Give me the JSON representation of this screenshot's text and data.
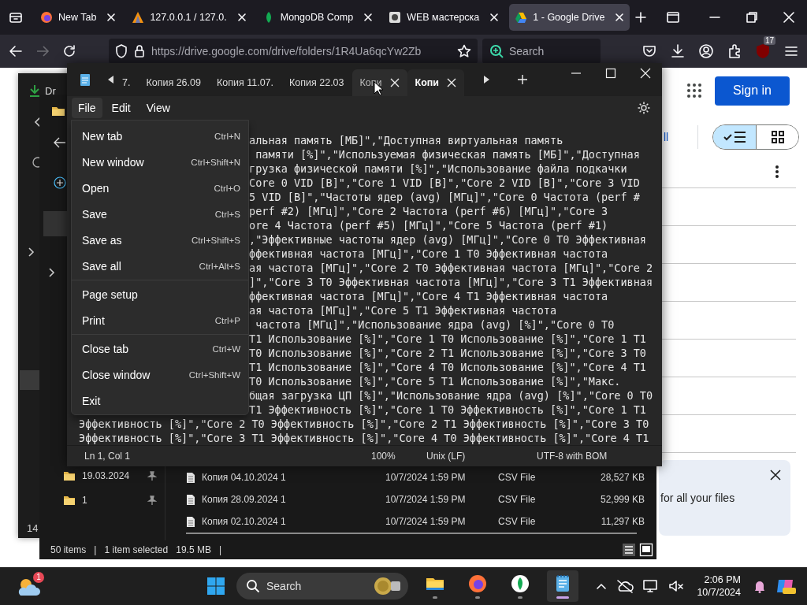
{
  "browser": {
    "tabs": [
      {
        "title": "New Tab",
        "selected": false
      },
      {
        "title": "127.0.0.1 / 127.0.",
        "selected": false
      },
      {
        "title": "MongoDB Comp",
        "selected": false
      },
      {
        "title": "WEB мастерска",
        "selected": false
      },
      {
        "title": "1 - Google Drive",
        "selected": true
      }
    ],
    "url": "https://drive.google.com/drive/folders/1R4Ua6qcYw2Zb",
    "search": {
      "placeholder": "Search"
    },
    "extension_badge": "17"
  },
  "drive_page": {
    "link": "ll",
    "sign_in": "Sign in",
    "view_toggle": [
      {
        "kind": "list",
        "selected": true
      },
      {
        "kind": "grid",
        "selected": false
      }
    ],
    "notice": {
      "text": "for all your files"
    }
  },
  "back_window": {
    "label": "Dr",
    "count": "14"
  },
  "explorer": {
    "sidebar_items": [
      {
        "label": "19.03.2024",
        "pinned": true
      },
      {
        "label": "1",
        "pinned": true
      }
    ],
    "files": [
      {
        "name": "Копия 04.10.2024 1",
        "modified": "10/7/2024 1:59 PM",
        "type": "CSV File",
        "size": "28,527 KB"
      },
      {
        "name": "Копия 28.09.2024 1",
        "modified": "10/7/2024 1:59 PM",
        "type": "CSV File",
        "size": "52,999 KB"
      },
      {
        "name": "Копия 02.10.2024 1",
        "modified": "10/7/2024 1:59 PM",
        "type": "CSV File",
        "size": "11,297 KB"
      }
    ],
    "status": [
      "50 items",
      "|",
      "1 item selected",
      "19.5 MB",
      "|"
    ]
  },
  "notepad": {
    "tabs": [
      {
        "title": "7.",
        "selected": false,
        "hovered": false,
        "closable": false
      },
      {
        "title": "Копия 26.09",
        "selected": false,
        "hovered": false,
        "closable": false
      },
      {
        "title": "Копия 11.07.",
        "selected": false,
        "hovered": false,
        "closable": false
      },
      {
        "title": "Копия 22.03",
        "selected": false,
        "hovered": false,
        "closable": false
      },
      {
        "title": "Копи",
        "selected": false,
        "hovered": true,
        "closable": true
      },
      {
        "title": "Копи",
        "selected": true,
        "hovered": false,
        "closable": true
      }
    ],
    "menus": [
      {
        "label": "File",
        "open": true
      },
      {
        "label": "Edit",
        "open": false
      },
      {
        "label": "View",
        "open": false
      }
    ],
    "file_menu": [
      {
        "items": [
          {
            "label": "New tab",
            "shortcut": "Ctrl+N"
          },
          {
            "label": "New window",
            "shortcut": "Ctrl+Shift+N"
          },
          {
            "label": "Open",
            "shortcut": "Ctrl+O"
          },
          {
            "label": "Save",
            "shortcut": "Ctrl+S"
          },
          {
            "label": "Save as",
            "shortcut": "Ctrl+Shift+S"
          },
          {
            "label": "Save all",
            "shortcut": "Ctrl+Alt+S"
          }
        ]
      },
      {
        "items": [
          {
            "label": "Page setup"
          },
          {
            "label": "Print",
            "shortcut": "Ctrl+P"
          }
        ]
      },
      {
        "items": [
          {
            "label": "Close tab",
            "shortcut": "Ctrl+W"
          },
          {
            "label": "Close window",
            "shortcut": "Ctrl+Shift+W"
          },
          {
            "label": "Exit"
          }
        ]
      }
    ],
    "lines_beside_menu": [
      "альная память [МБ]\",\"Доступная виртуальная память",
      " памяти [%]\",\"Используемая физическая память [МБ]\",\"Доступная",
      "грузка физической памяти [%]\",\"Использование файла подкачки",
      "Core 0 VID [В]\",\"Core 1 VID [В]\",\"Core 2 VID [В]\",\"Core 3 VID",
      "5 VID [В]\",\"Частоты ядер (avg) [МГц]\",\"Core 0 Частота (perf #",
      "perf #2) [МГц]\",\"Core 2 Частота (perf #6) [МГц]\",\"Core 3",
      "ore 4 Частота (perf #5) [МГц]\",\"Core 5 Частота (perf #1)",
      ",\"Эффективные частоты ядер (avg) [МГц]\",\"Core 0 T0 Эффективная",
      "ффективная частота [МГц]\",\"Core 1 T0 Эффективная частота",
      "ая частота [МГц]\",\"Core 2 T0 Эффективная частота [МГц]\",\"Core 2",
      "]\",\"Core 3 T0 Эффективная частота [МГц]\",\"Core 3 T1 Эффективная",
      "ффективная частота [МГц]\",\"Core 4 T1 Эффективная частота",
      "ая частота [МГц]\",\"Core 5 T1 Эффективная частота",
      " частота [МГц]\",\"Использование ядра (avg) [%]\",\"Core 0 T0",
      "T1 Использование [%]\",\"Core 1 T0 Использование [%]\",\"Core 1 T1",
      "T0 Использование [%]\",\"Core 2 T1 Использование [%]\",\"Core 3 T0",
      "T1 Использование [%]\",\"Core 4 T0 Использование [%]\",\"Core 4 T1",
      "T0 Использование [%]\",\"Core 5 T1 Использование [%]\",\"Макс.",
      "бщая загрузка ЦП [%]\",\"Использование ядра (avg) [%]\",\"Core 0 T0",
      "T1 Эффективность [%]\",\"Core 1 T0 Эффективность [%]\",\"Core 1 T1"
    ],
    "lines": [
      "Эффективность [%]\",\"Core 2 T0 Эффективность [%]\",\"Core 2 T1 Эффективность [%]\",\"Core 3 T0",
      "Эффективность [%]\",\"Core 3 T1 Эффективность [%]\",\"Core 4 T0 Эффективность [%]\",\"Core 4 T1"
    ],
    "status": {
      "position": "Ln 1, Col 1",
      "zoom": "100%",
      "line_ending": "Unix (LF)",
      "encoding": "UTF-8 with BOM"
    }
  },
  "taskbar": {
    "weather_badge": "1",
    "search": {
      "placeholder": "Search"
    },
    "apps": [
      {
        "kind": "explorer",
        "active": false
      },
      {
        "kind": "firefox",
        "active": false
      },
      {
        "kind": "mongodb",
        "active": false
      },
      {
        "kind": "notepad",
        "active": true
      }
    ],
    "time": "2:06 PM",
    "date": "10/7/2024"
  }
}
